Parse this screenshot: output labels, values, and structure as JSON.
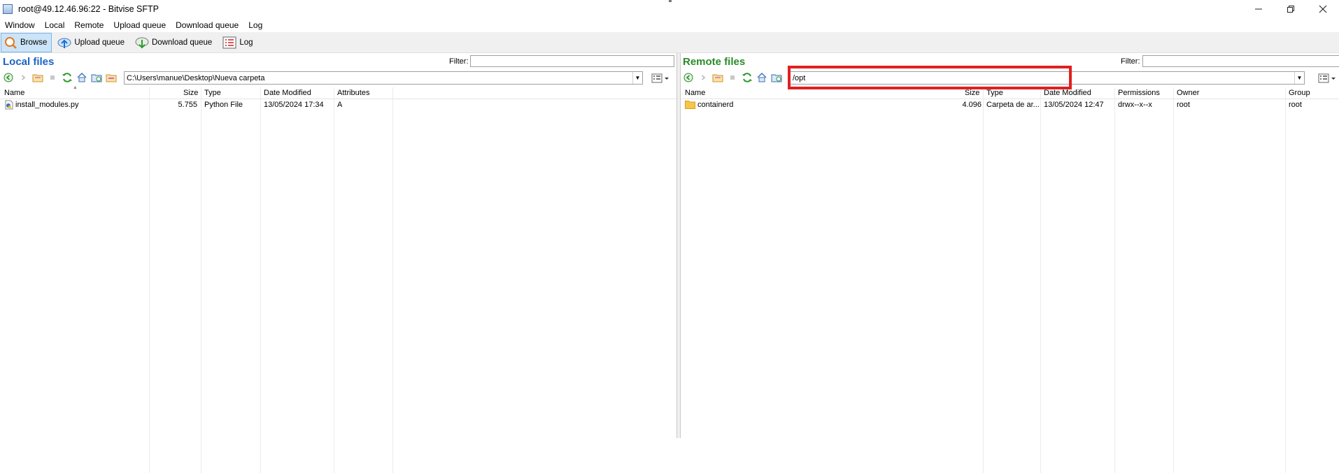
{
  "window": {
    "title": "root@49.12.46.96:22 - Bitvise SFTP",
    "controls": [
      "minimize",
      "restore",
      "close"
    ]
  },
  "menu": [
    "Window",
    "Local",
    "Remote",
    "Upload queue",
    "Download queue",
    "Log"
  ],
  "toolbar": [
    {
      "label": "Browse",
      "icon": "browse-icon",
      "active": true
    },
    {
      "label": "Upload queue",
      "icon": "upload-cloud-icon"
    },
    {
      "label": "Download queue",
      "icon": "download-cloud-icon"
    },
    {
      "label": "Log",
      "icon": "log-icon"
    }
  ],
  "local": {
    "title": "Local files",
    "filter_label": "Filter:",
    "filter_value": "",
    "path": "C:\\Users\\manue\\Desktop\\Nueva carpeta",
    "columns": [
      "Name",
      "Size",
      "Type",
      "Date Modified",
      "Attributes"
    ],
    "rows": [
      {
        "name": "install_modules.py",
        "size": "5.755",
        "type": "Python File",
        "modified": "13/05/2024 17:34",
        "attributes": "A"
      }
    ]
  },
  "remote": {
    "title": "Remote files",
    "filter_label": "Filter:",
    "filter_value": "",
    "path": "/opt",
    "columns": [
      "Name",
      "Size",
      "Type",
      "Date Modified",
      "Permissions",
      "Owner",
      "Group"
    ],
    "rows": [
      {
        "name": "containerd",
        "size": "4.096",
        "type": "Carpeta de ar...",
        "modified": "13/05/2024 12:47",
        "permissions": "drwx--x--x",
        "owner": "root",
        "group": "root"
      }
    ]
  },
  "colors": {
    "local_title": "#1b63c6",
    "remote_title": "#2a8a2a",
    "highlight": "#e02020",
    "active_button": "#cce4f7"
  }
}
